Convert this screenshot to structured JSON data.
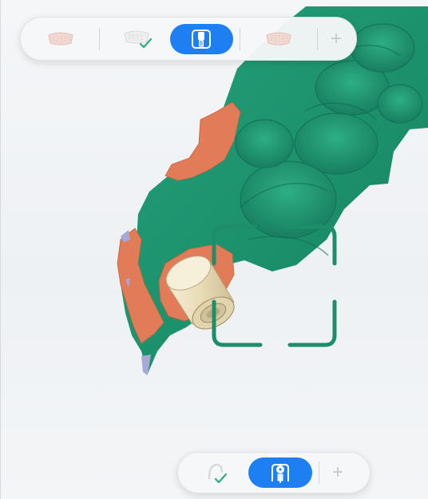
{
  "top_toolbar": {
    "items": [
      {
        "id": "upper-jaw",
        "icon": "upper-jaw-icon",
        "state": "disabled"
      },
      {
        "id": "lower-jaw-done",
        "icon": "lower-jaw-check-icon",
        "state": "completed"
      },
      {
        "id": "scanbody",
        "icon": "scanbody-icon",
        "state": "active"
      },
      {
        "id": "opposing-jaw",
        "icon": "jaw-icon",
        "state": "disabled"
      }
    ],
    "add_label": "+"
  },
  "bottom_toolbar": {
    "items": [
      {
        "id": "gingiva-done",
        "icon": "gingiva-check-icon",
        "state": "completed"
      },
      {
        "id": "implant-scan",
        "icon": "implant-scan-icon",
        "state": "active"
      }
    ],
    "add_label": "+"
  },
  "colors": {
    "accent": "#1d7ff2",
    "tissue_green": "#1f9872",
    "margin_orange": "#e17a55",
    "focus_frame": "#1e8e6a",
    "scanbody": "#efe3c2"
  }
}
